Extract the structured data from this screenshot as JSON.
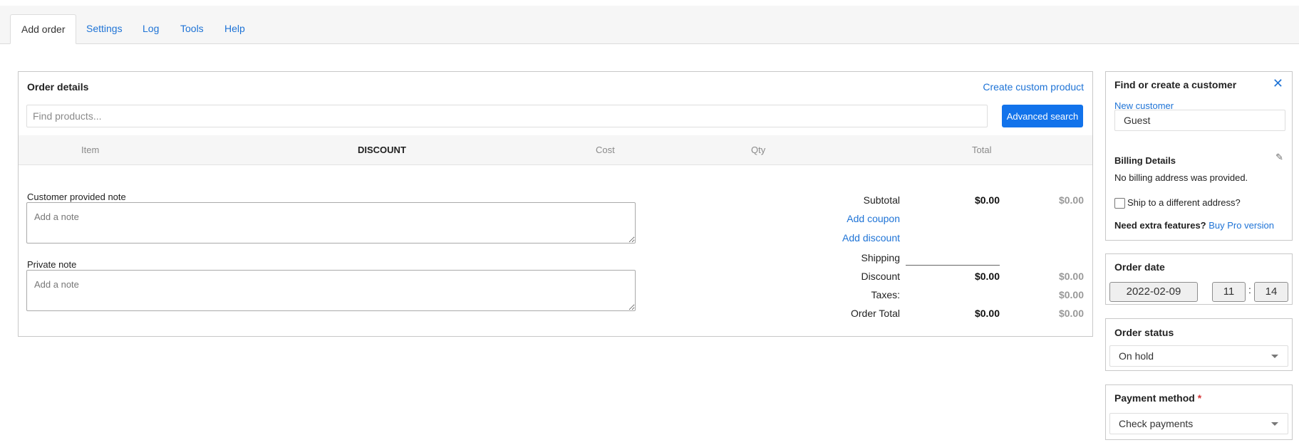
{
  "tabs": [
    {
      "label": "Add order",
      "active": true
    },
    {
      "label": "Settings"
    },
    {
      "label": "Log"
    },
    {
      "label": "Tools"
    },
    {
      "label": "Help"
    }
  ],
  "order": {
    "title": "Order details",
    "create_custom_product": "Create custom product",
    "search_placeholder": "Find products...",
    "advanced_search": "Advanced search",
    "columns": {
      "item": "Item",
      "discount": "DISCOUNT",
      "cost": "Cost",
      "qty": "Qty",
      "total": "Total"
    },
    "customer_note_label": "Customer provided note",
    "customer_note_placeholder": "Add a note",
    "private_note_label": "Private note",
    "private_note_placeholder": "Add a note",
    "totals": {
      "subtotal_label": "Subtotal",
      "subtotal_value": "$0.00",
      "subtotal_gray": "$0.00",
      "add_coupon": "Add coupon",
      "add_discount": "Add discount",
      "shipping_label": "Shipping",
      "discount_label": "Discount",
      "discount_value": "$0.00",
      "discount_gray": "$0.00",
      "taxes_label": "Taxes:",
      "taxes_gray": "$0.00",
      "order_total_label": "Order Total",
      "order_total_value": "$0.00",
      "order_total_gray": "$0.00"
    }
  },
  "customer": {
    "title": "Find or create a customer",
    "close": "✕",
    "new_customer": "New customer",
    "value": "Guest",
    "billing_title": "Billing Details",
    "billing_text": "No billing address was provided.",
    "ship_label": "Ship to a different address?",
    "extra_label": "Need extra features?",
    "buy_pro": "Buy Pro version"
  },
  "order_date": {
    "title": "Order date",
    "date": "2022-02-09",
    "hour": "11",
    "separator": ":",
    "minute": "14"
  },
  "order_status": {
    "title": "Order status",
    "value": "On hold"
  },
  "payment": {
    "title": "Payment method",
    "required_mark": "*",
    "value": "Check payments"
  },
  "colors": {
    "accent": "#1273eb",
    "link": "#1e73d6",
    "border": "#c8c8c8"
  }
}
